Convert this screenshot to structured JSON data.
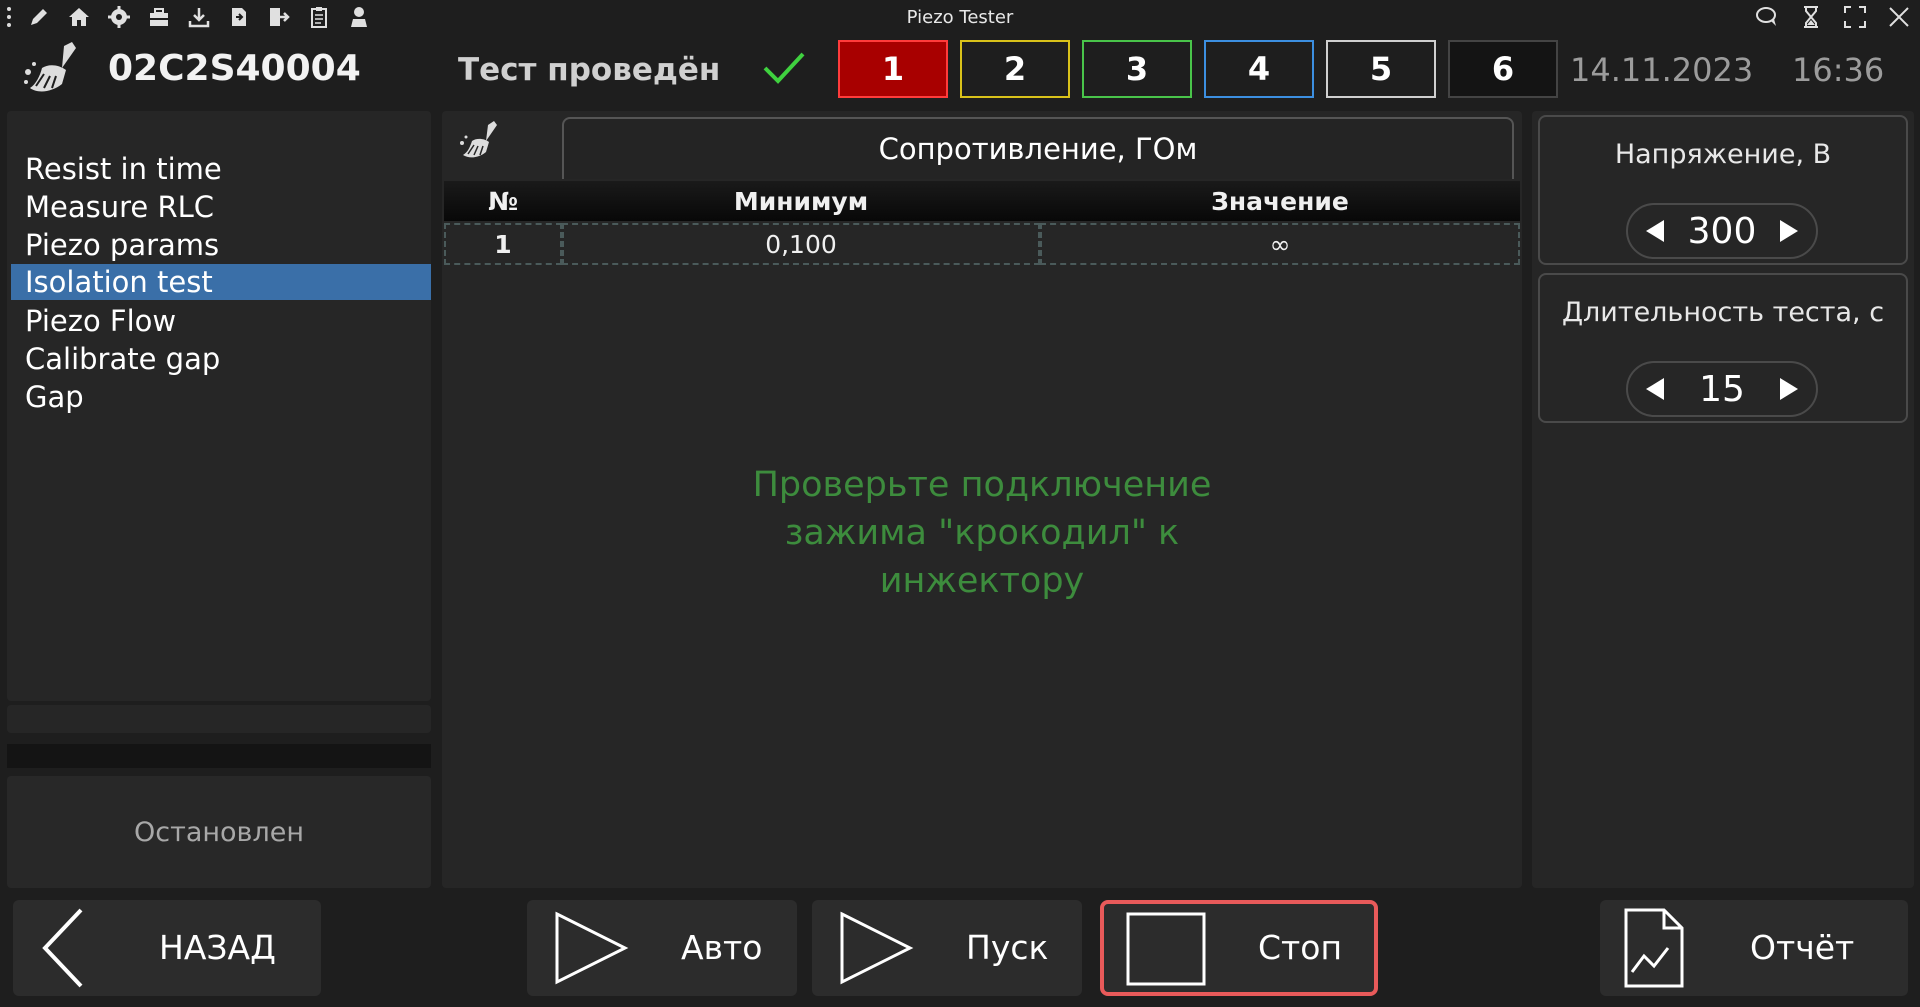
{
  "titlebar": {
    "app_title": "Piezo Tester",
    "left_icons": [
      "menu-dots-icon",
      "pencil-icon",
      "home-icon",
      "gear-icon",
      "toolbox-icon",
      "download-icon",
      "import-icon",
      "export-icon",
      "clipboard-icon",
      "user-icon"
    ],
    "right_icons": [
      "chat-icon",
      "hourglass-icon",
      "fullscreen-icon",
      "close-icon"
    ]
  },
  "header": {
    "serial": "02C2S40004",
    "status": "Тест проведён",
    "channels": [
      "1",
      "2",
      "3",
      "4",
      "5",
      "6"
    ],
    "active_channel": "1",
    "date": "14.11.2023",
    "time": "16:36"
  },
  "sidebar": {
    "items": [
      {
        "label": "Resist in time"
      },
      {
        "label": "Measure RLC"
      },
      {
        "label": "Piezo params"
      },
      {
        "label": "Isolation test"
      },
      {
        "label": "Piezo Flow"
      },
      {
        "label": "Calibrate gap"
      },
      {
        "label": "Gap"
      }
    ],
    "selected": "Isolation test",
    "state": "Остановлен"
  },
  "main": {
    "section_title": "Сопротивление, ГОм",
    "columns": [
      "№",
      "Минимум",
      "Значение"
    ],
    "rows": [
      {
        "num": "1",
        "min": "0,100",
        "value": "∞"
      }
    ],
    "message_lines": [
      "Проверьте подключение",
      "зажима \"крокодил\" к",
      "инжектору"
    ]
  },
  "settings": {
    "voltage_label": "Напряжение, В",
    "voltage_value": "300",
    "duration_label": "Длительность теста, с",
    "duration_value": "15"
  },
  "buttons": {
    "back": "НАЗАД",
    "auto": "Авто",
    "start": "Пуск",
    "stop": "Стоп",
    "report": "Отчёт"
  },
  "colors": {
    "accent_selected": "#3a6fa8",
    "message_green": "#3d8c3d",
    "stop_border": "#e85a5a",
    "check_green": "#3fd13f"
  }
}
